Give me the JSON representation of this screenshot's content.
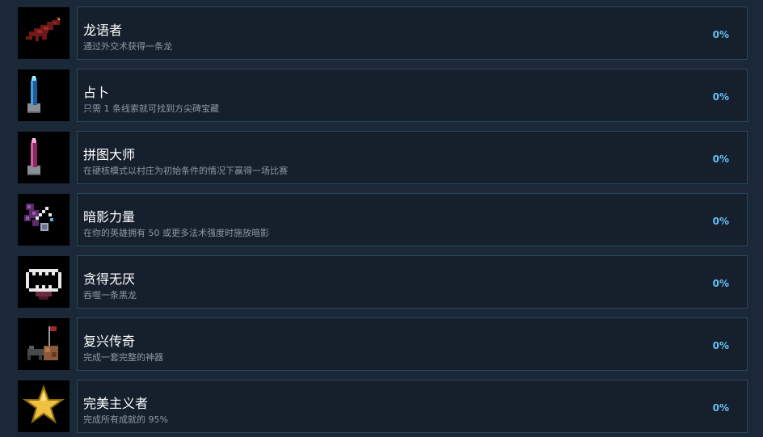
{
  "achievements": [
    {
      "title": "龙语者",
      "description": "通过外交术获得一条龙",
      "percent": "0%",
      "icon": "dragon-icon",
      "accent": "#7a1c1c"
    },
    {
      "title": "占卜",
      "description": "只需 1 条线索就可找到方尖碑宝藏",
      "percent": "0%",
      "icon": "blue-obelisk-icon",
      "accent": "#3fa0e0"
    },
    {
      "title": "拼图大师",
      "description": "在硬核模式以村庄为初始条件的情况下赢得一场比赛",
      "percent": "0%",
      "icon": "pink-obelisk-icon",
      "accent": "#d060a0"
    },
    {
      "title": "暗影力量",
      "description": "在你的英雄拥有 50 或更多法术强度时施放暗影",
      "percent": "0%",
      "icon": "shadow-magic-icon",
      "accent": "#8a4a9a"
    },
    {
      "title": "贪得无厌",
      "description": "吞噬一条黑龙",
      "percent": "0%",
      "icon": "devour-mouth-icon",
      "accent": "#e0e0e0"
    },
    {
      "title": "复兴传奇",
      "description": "完成一套完整的神器",
      "percent": "0%",
      "icon": "artifact-set-icon",
      "accent": "#8a5a3a"
    },
    {
      "title": "完美主义者",
      "description": "完成所有成就的 95%",
      "percent": "0%",
      "icon": "gold-star-icon",
      "accent": "#f0c040"
    }
  ]
}
